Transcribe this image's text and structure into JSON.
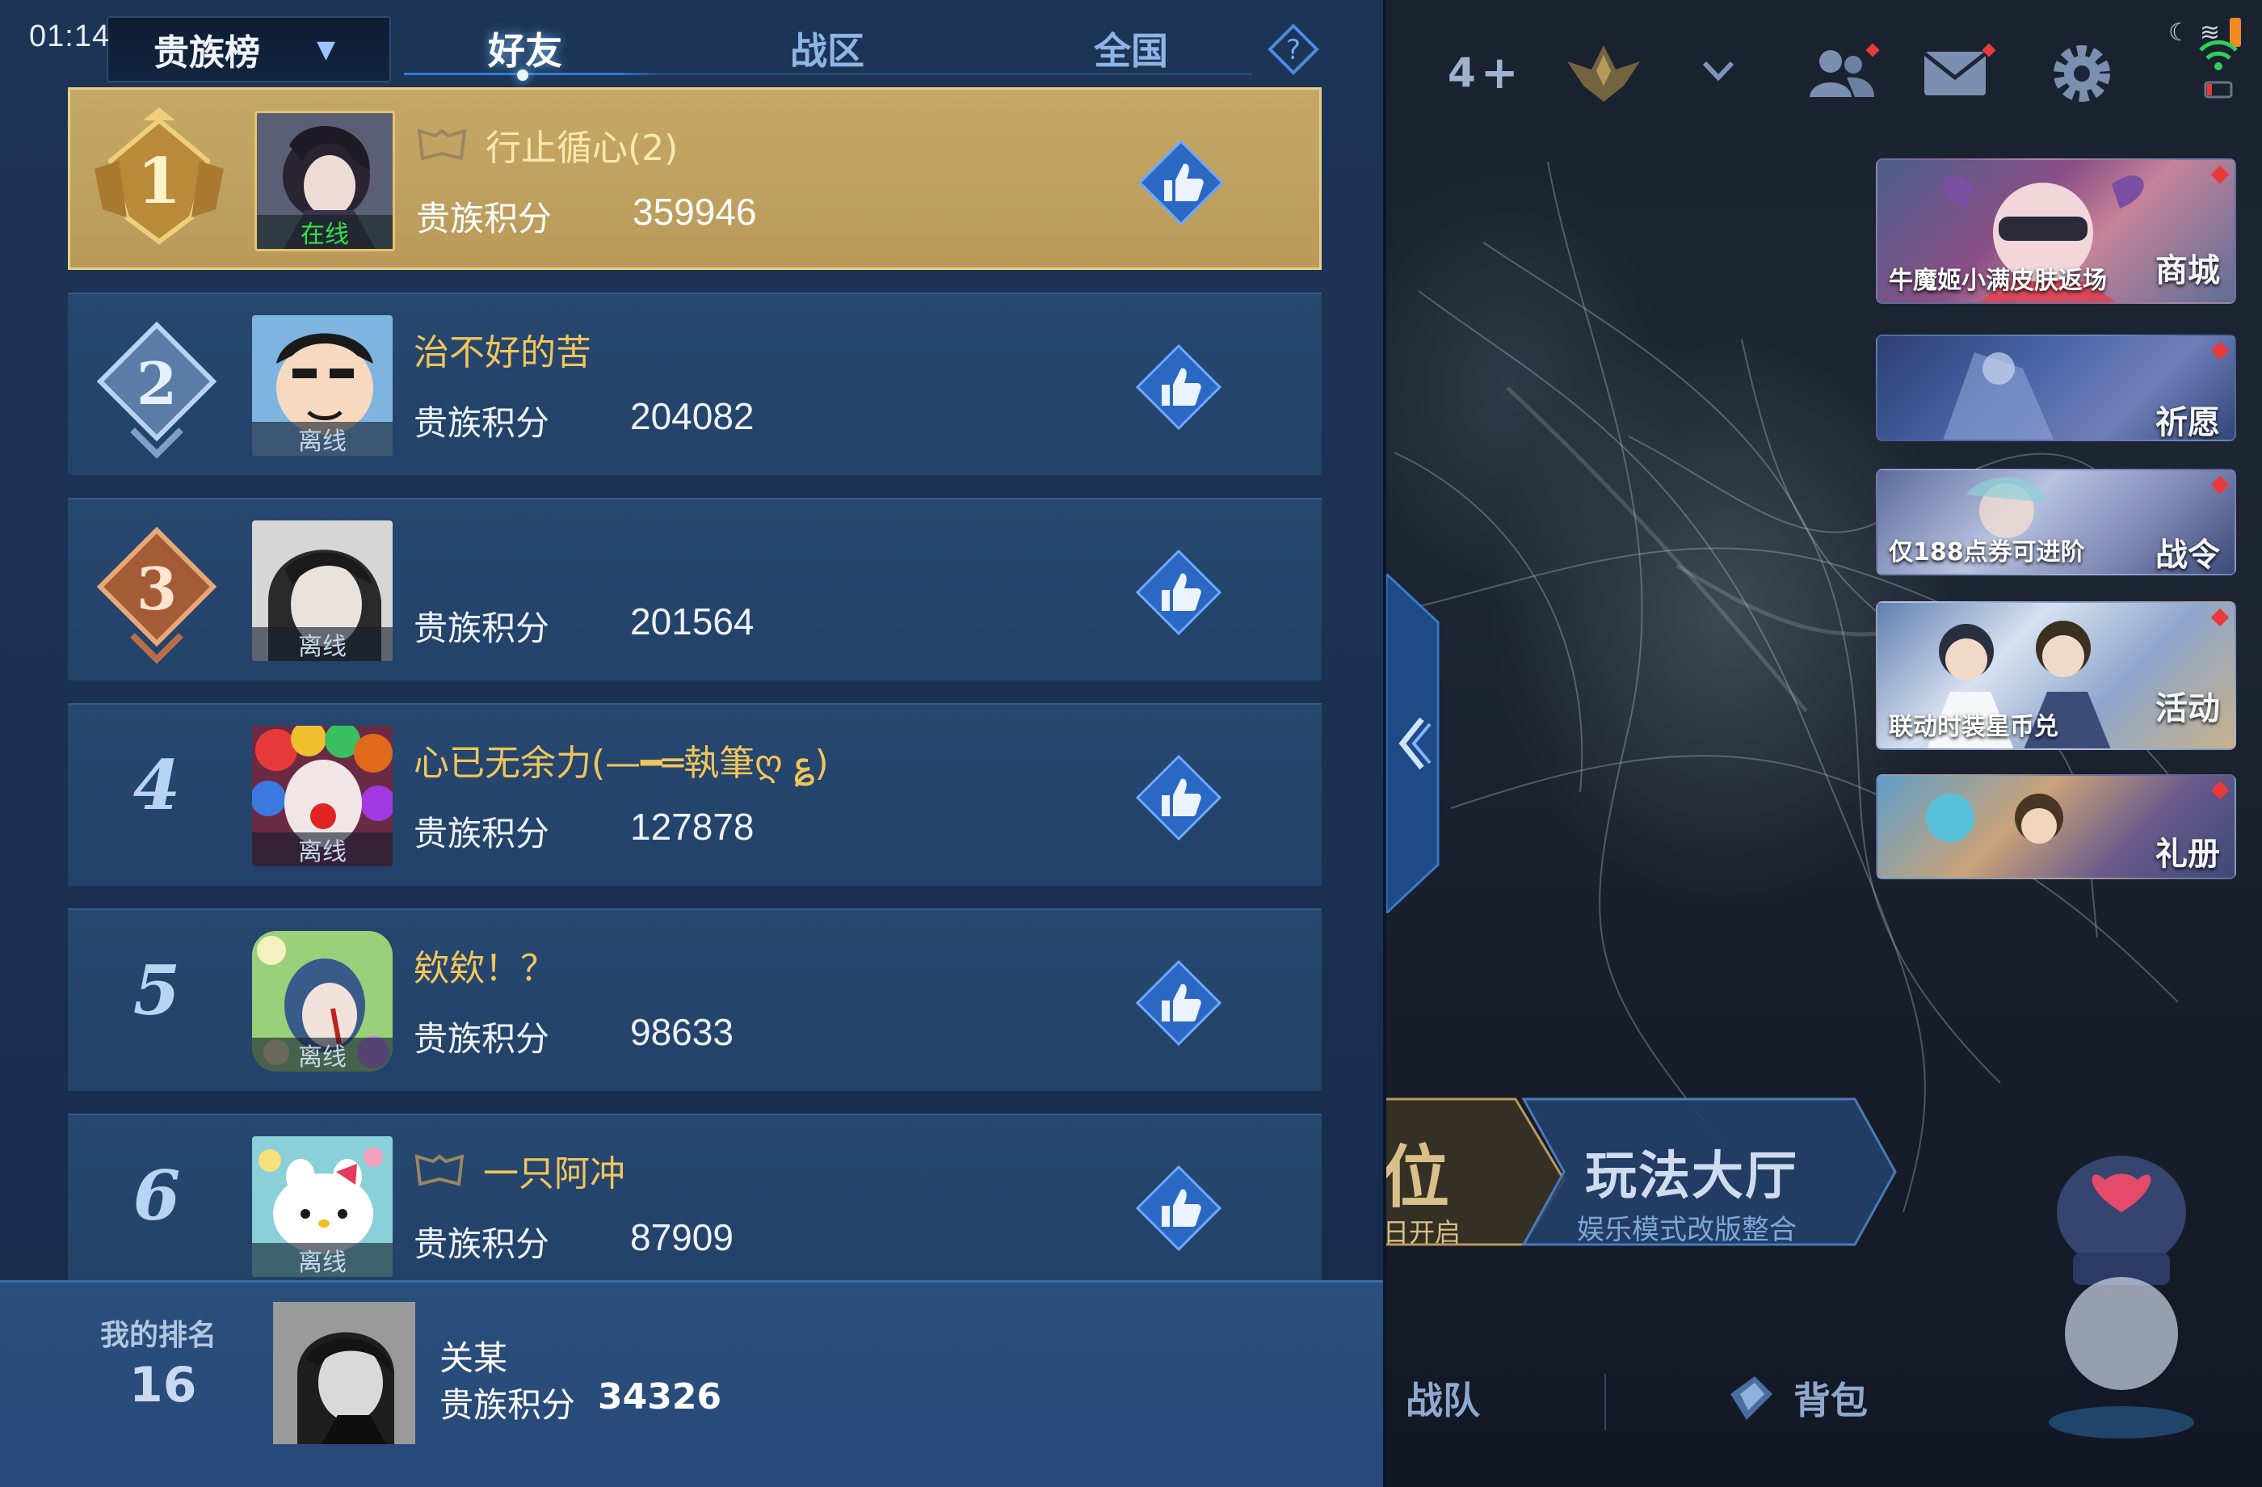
{
  "status_bar": {
    "time": "01:14"
  },
  "header": {
    "dropdown_label": "贵族榜",
    "tabs": [
      {
        "label": "好友",
        "active": true
      },
      {
        "label": "战区",
        "active": false
      },
      {
        "label": "全国",
        "active": false
      }
    ]
  },
  "score_label": "贵族积分",
  "rows": [
    {
      "rank": "1",
      "name": "行止循心(2)",
      "status": "在线",
      "score": "359946"
    },
    {
      "rank": "2",
      "name": "治不好的苦",
      "status": "离线",
      "score": "204082"
    },
    {
      "rank": "3",
      "name": "",
      "status": "离线",
      "score": "201564"
    },
    {
      "rank": "4",
      "name": "心已无余力(—━═執筆ღ ؏)",
      "status": "离线",
      "score": "127878"
    },
    {
      "rank": "5",
      "name": "欸欸！？",
      "status": "离线",
      "score": "98633"
    },
    {
      "rank": "6",
      "name": "一只阿冲",
      "status": "离线",
      "score": "87909"
    }
  ],
  "my_rank": {
    "label": "我的排名",
    "rank": "16",
    "name": "关某",
    "score_label": "贵族积分",
    "score": "34326"
  },
  "lobby": {
    "friend_count": "4",
    "events": [
      {
        "big": "商城",
        "small": "牛魔姬小满皮肤返场"
      },
      {
        "big": "祈愿",
        "small": ""
      },
      {
        "big": "战令",
        "small": "仅188点券可进阶"
      },
      {
        "big": "活动",
        "small": "联动时装星币兑"
      },
      {
        "big": "礼册",
        "small": ""
      }
    ],
    "mode_partial": "位",
    "mode_partial_sub": "日开启",
    "mode_title": "玩法大厅",
    "mode_subtitle": "娱乐模式改版整合",
    "nav_team": "战队",
    "nav_bag": "背包"
  },
  "colors": {
    "panel_bg": "#1c3456",
    "row_bg": "#26476f",
    "first_row_gold": "#c6a866",
    "name_gold": "#f2c55a",
    "online_green": "#35e04a",
    "accent_blue": "#2a7de0"
  }
}
